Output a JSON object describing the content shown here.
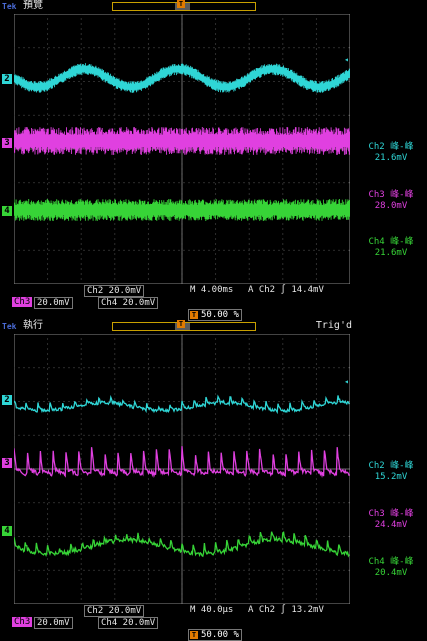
{
  "colors": {
    "ch2": "#2fd6d6",
    "ch3": "#e040e0",
    "ch4": "#37d437",
    "accent": "#e07a00",
    "brand": "#4a6bd6"
  },
  "top": {
    "brand": "Tek",
    "mode": "預覽",
    "trig_status": "",
    "trigger_marker": "T",
    "measurements": [
      {
        "label": "Ch2 峰-峰",
        "value": "21.6mV",
        "color": "ch2"
      },
      {
        "label": "Ch3 峰-峰",
        "value": "28.0mV",
        "color": "ch3"
      },
      {
        "label": "Ch4 峰-峰",
        "value": "21.6mV",
        "color": "ch4"
      }
    ],
    "ch2_scale": "Ch2  20.0mV",
    "timebase": "M 4.00ms",
    "trig_source": "A  Ch2  ∫  14.4mV",
    "ch3_scale": "20.0mV",
    "ch3_label": "Ch3",
    "ch4_scale": "Ch4  20.0mV",
    "trig_pos": "50.00 %"
  },
  "bottom": {
    "brand": "Tek",
    "mode": "執行",
    "trig_status": "Trig'd",
    "trigger_marker": "T",
    "measurements": [
      {
        "label": "Ch2 峰-峰",
        "value": "15.2mV",
        "color": "ch2"
      },
      {
        "label": "Ch3 峰-峰",
        "value": "24.4mV",
        "color": "ch3"
      },
      {
        "label": "Ch4 峰-峰",
        "value": "20.4mV",
        "color": "ch4"
      }
    ],
    "ch2_scale": "Ch2  20.0mV",
    "timebase": "M 40.0µs",
    "trig_source": "A  Ch2  ∫  13.2mV",
    "ch3_scale": "20.0mV",
    "ch3_label": "Ch3",
    "ch4_scale": "Ch4  20.0mV",
    "trig_pos": "50.00 %"
  },
  "channel_markers": {
    "ch2": "2",
    "ch3": "3",
    "ch4": "4"
  }
}
